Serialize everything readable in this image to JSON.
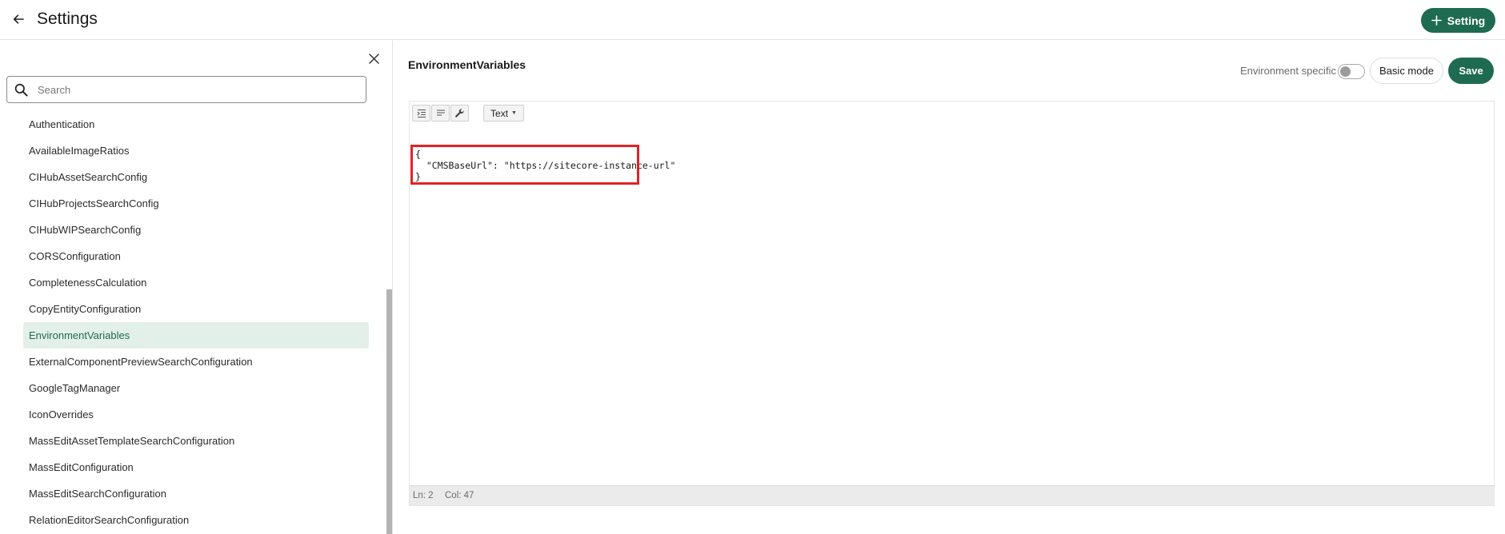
{
  "header": {
    "title": "Settings",
    "add_setting_label": "Setting"
  },
  "sidebar": {
    "search_placeholder": "Search",
    "items": [
      {
        "label": "Authentication"
      },
      {
        "label": "AvailableImageRatios"
      },
      {
        "label": "CIHubAssetSearchConfig"
      },
      {
        "label": "CIHubProjectsSearchConfig"
      },
      {
        "label": "CIHubWIPSearchConfig"
      },
      {
        "label": "CORSConfiguration"
      },
      {
        "label": "CompletenessCalculation"
      },
      {
        "label": "CopyEntityConfiguration"
      },
      {
        "label": "EnvironmentVariables",
        "active": true
      },
      {
        "label": "ExternalComponentPreviewSearchConfiguration"
      },
      {
        "label": "GoogleTagManager"
      },
      {
        "label": "IconOverrides"
      },
      {
        "label": "MassEditAssetTemplateSearchConfiguration"
      },
      {
        "label": "MassEditConfiguration"
      },
      {
        "label": "MassEditSearchConfiguration"
      },
      {
        "label": "RelationEditorSearchConfiguration"
      }
    ]
  },
  "main": {
    "setting_name": "EnvironmentVariables",
    "env_specific_label": "Environment specific",
    "env_specific_on": false,
    "basic_mode_label": "Basic mode",
    "save_label": "Save",
    "editor": {
      "mode_label": "Text",
      "lines": [
        "{",
        "  \"CMSBaseUrl\": \"https://sitecore-instance-url\"",
        "}"
      ],
      "status": {
        "line": "Ln: 2",
        "col": "Col: 47"
      }
    }
  },
  "colors": {
    "brand_green": "#1e6b52",
    "active_bg": "#e3f0ea",
    "highlight_red": "#e02424"
  },
  "icons": {
    "back": "arrow-left-icon",
    "add": "plus-icon",
    "close": "close-icon",
    "search": "magnifier-icon",
    "indent": "format-indent-icon",
    "compact": "format-compact-icon",
    "repair": "wrench-icon"
  }
}
